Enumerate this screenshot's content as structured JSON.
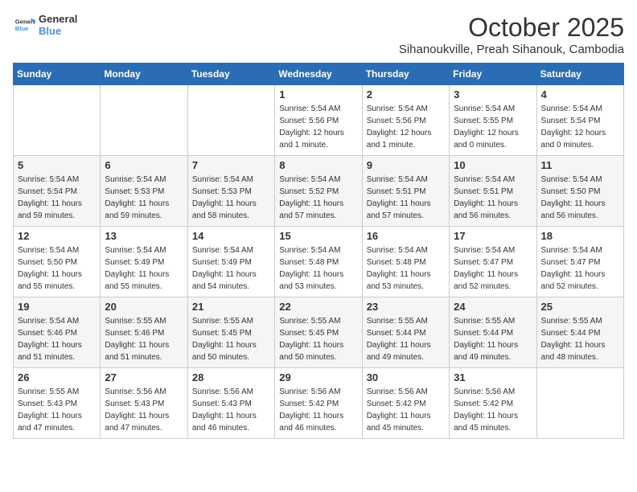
{
  "header": {
    "logo_line1": "General",
    "logo_line2": "Blue",
    "month": "October 2025",
    "location": "Sihanoukville, Preah Sihanouk, Cambodia"
  },
  "weekdays": [
    "Sunday",
    "Monday",
    "Tuesday",
    "Wednesday",
    "Thursday",
    "Friday",
    "Saturday"
  ],
  "weeks": [
    [
      {
        "day": "",
        "info": ""
      },
      {
        "day": "",
        "info": ""
      },
      {
        "day": "",
        "info": ""
      },
      {
        "day": "1",
        "info": "Sunrise: 5:54 AM\nSunset: 5:56 PM\nDaylight: 12 hours\nand 1 minute."
      },
      {
        "day": "2",
        "info": "Sunrise: 5:54 AM\nSunset: 5:56 PM\nDaylight: 12 hours\nand 1 minute."
      },
      {
        "day": "3",
        "info": "Sunrise: 5:54 AM\nSunset: 5:55 PM\nDaylight: 12 hours\nand 0 minutes."
      },
      {
        "day": "4",
        "info": "Sunrise: 5:54 AM\nSunset: 5:54 PM\nDaylight: 12 hours\nand 0 minutes."
      }
    ],
    [
      {
        "day": "5",
        "info": "Sunrise: 5:54 AM\nSunset: 5:54 PM\nDaylight: 11 hours\nand 59 minutes."
      },
      {
        "day": "6",
        "info": "Sunrise: 5:54 AM\nSunset: 5:53 PM\nDaylight: 11 hours\nand 59 minutes."
      },
      {
        "day": "7",
        "info": "Sunrise: 5:54 AM\nSunset: 5:53 PM\nDaylight: 11 hours\nand 58 minutes."
      },
      {
        "day": "8",
        "info": "Sunrise: 5:54 AM\nSunset: 5:52 PM\nDaylight: 11 hours\nand 57 minutes."
      },
      {
        "day": "9",
        "info": "Sunrise: 5:54 AM\nSunset: 5:51 PM\nDaylight: 11 hours\nand 57 minutes."
      },
      {
        "day": "10",
        "info": "Sunrise: 5:54 AM\nSunset: 5:51 PM\nDaylight: 11 hours\nand 56 minutes."
      },
      {
        "day": "11",
        "info": "Sunrise: 5:54 AM\nSunset: 5:50 PM\nDaylight: 11 hours\nand 56 minutes."
      }
    ],
    [
      {
        "day": "12",
        "info": "Sunrise: 5:54 AM\nSunset: 5:50 PM\nDaylight: 11 hours\nand 55 minutes."
      },
      {
        "day": "13",
        "info": "Sunrise: 5:54 AM\nSunset: 5:49 PM\nDaylight: 11 hours\nand 55 minutes."
      },
      {
        "day": "14",
        "info": "Sunrise: 5:54 AM\nSunset: 5:49 PM\nDaylight: 11 hours\nand 54 minutes."
      },
      {
        "day": "15",
        "info": "Sunrise: 5:54 AM\nSunset: 5:48 PM\nDaylight: 11 hours\nand 53 minutes."
      },
      {
        "day": "16",
        "info": "Sunrise: 5:54 AM\nSunset: 5:48 PM\nDaylight: 11 hours\nand 53 minutes."
      },
      {
        "day": "17",
        "info": "Sunrise: 5:54 AM\nSunset: 5:47 PM\nDaylight: 11 hours\nand 52 minutes."
      },
      {
        "day": "18",
        "info": "Sunrise: 5:54 AM\nSunset: 5:47 PM\nDaylight: 11 hours\nand 52 minutes."
      }
    ],
    [
      {
        "day": "19",
        "info": "Sunrise: 5:54 AM\nSunset: 5:46 PM\nDaylight: 11 hours\nand 51 minutes."
      },
      {
        "day": "20",
        "info": "Sunrise: 5:55 AM\nSunset: 5:46 PM\nDaylight: 11 hours\nand 51 minutes."
      },
      {
        "day": "21",
        "info": "Sunrise: 5:55 AM\nSunset: 5:45 PM\nDaylight: 11 hours\nand 50 minutes."
      },
      {
        "day": "22",
        "info": "Sunrise: 5:55 AM\nSunset: 5:45 PM\nDaylight: 11 hours\nand 50 minutes."
      },
      {
        "day": "23",
        "info": "Sunrise: 5:55 AM\nSunset: 5:44 PM\nDaylight: 11 hours\nand 49 minutes."
      },
      {
        "day": "24",
        "info": "Sunrise: 5:55 AM\nSunset: 5:44 PM\nDaylight: 11 hours\nand 49 minutes."
      },
      {
        "day": "25",
        "info": "Sunrise: 5:55 AM\nSunset: 5:44 PM\nDaylight: 11 hours\nand 48 minutes."
      }
    ],
    [
      {
        "day": "26",
        "info": "Sunrise: 5:55 AM\nSunset: 5:43 PM\nDaylight: 11 hours\nand 47 minutes."
      },
      {
        "day": "27",
        "info": "Sunrise: 5:56 AM\nSunset: 5:43 PM\nDaylight: 11 hours\nand 47 minutes."
      },
      {
        "day": "28",
        "info": "Sunrise: 5:56 AM\nSunset: 5:43 PM\nDaylight: 11 hours\nand 46 minutes."
      },
      {
        "day": "29",
        "info": "Sunrise: 5:56 AM\nSunset: 5:42 PM\nDaylight: 11 hours\nand 46 minutes."
      },
      {
        "day": "30",
        "info": "Sunrise: 5:56 AM\nSunset: 5:42 PM\nDaylight: 11 hours\nand 45 minutes."
      },
      {
        "day": "31",
        "info": "Sunrise: 5:56 AM\nSunset: 5:42 PM\nDaylight: 11 hours\nand 45 minutes."
      },
      {
        "day": "",
        "info": ""
      }
    ]
  ]
}
